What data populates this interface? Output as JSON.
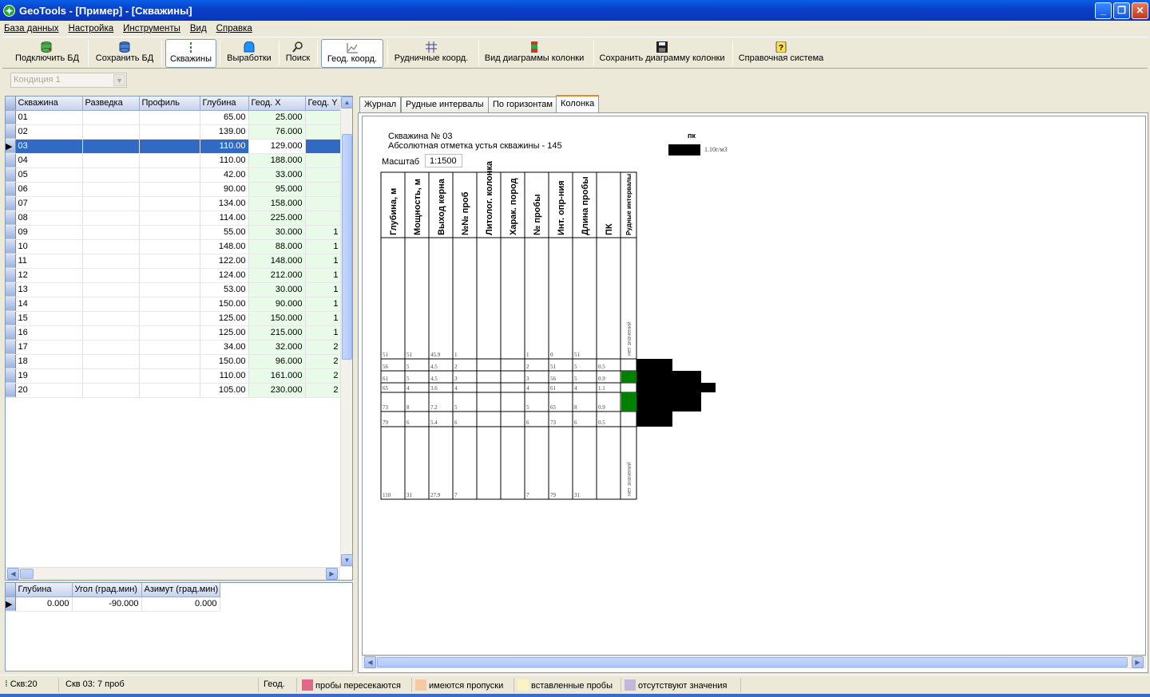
{
  "window": {
    "title": "GeoTools - [Пример] - [Скважины]",
    "min": "_",
    "max": "❐",
    "close": "✕"
  },
  "menu": [
    "База данных",
    "Настройка",
    "Инструменты",
    "Вид",
    "Справка"
  ],
  "toolbar": [
    {
      "label": "Подключить БД",
      "icon": "db-connect-icon"
    },
    {
      "label": "Сохранить БД",
      "icon": "db-save-icon"
    },
    {
      "label": "Скважины",
      "icon": "wells-icon",
      "active": true
    },
    {
      "label": "Выработки",
      "icon": "workings-icon"
    },
    {
      "label": "Поиск",
      "icon": "search-icon"
    },
    {
      "label": "Геод. коорд.",
      "icon": "geod-coords-icon",
      "active": true
    },
    {
      "label": "Рудничные коорд.",
      "icon": "mine-coords-icon"
    },
    {
      "label": "Вид диаграммы колонки",
      "icon": "column-diagram-icon"
    },
    {
      "label": "Сохранить диаграмму колонки",
      "icon": "save-diagram-icon"
    },
    {
      "label": "Справочная система",
      "icon": "help-icon"
    }
  ],
  "condition": {
    "value": "Кондиция 1"
  },
  "wells": {
    "columns": [
      "Скважина",
      "Разведка",
      "Профиль",
      "Глубина",
      "Геод. X",
      "Геод. Y"
    ],
    "selected_row": 2,
    "rows": [
      [
        "01",
        "",
        "",
        "65.00",
        "25.000",
        ""
      ],
      [
        "02",
        "",
        "",
        "139.00",
        "76.000",
        ""
      ],
      [
        "03",
        "",
        "",
        "110.00",
        "129.000",
        ""
      ],
      [
        "04",
        "",
        "",
        "110.00",
        "188.000",
        ""
      ],
      [
        "05",
        "",
        "",
        "42.00",
        "33.000",
        ""
      ],
      [
        "06",
        "",
        "",
        "90.00",
        "95.000",
        ""
      ],
      [
        "07",
        "",
        "",
        "134.00",
        "158.000",
        ""
      ],
      [
        "08",
        "",
        "",
        "114.00",
        "225.000",
        ""
      ],
      [
        "09",
        "",
        "",
        "55.00",
        "30.000",
        "1"
      ],
      [
        "10",
        "",
        "",
        "148.00",
        "88.000",
        "1"
      ],
      [
        "11",
        "",
        "",
        "122.00",
        "148.000",
        "1"
      ],
      [
        "12",
        "",
        "",
        "124.00",
        "212.000",
        "1"
      ],
      [
        "13",
        "",
        "",
        "53.00",
        "30.000",
        "1"
      ],
      [
        "14",
        "",
        "",
        "150.00",
        "90.000",
        "1"
      ],
      [
        "15",
        "",
        "",
        "125.00",
        "150.000",
        "1"
      ],
      [
        "16",
        "",
        "",
        "125.00",
        "215.000",
        "1"
      ],
      [
        "17",
        "",
        "",
        "34.00",
        "32.000",
        "2"
      ],
      [
        "18",
        "",
        "",
        "150.00",
        "96.000",
        "2"
      ],
      [
        "19",
        "",
        "",
        "110.00",
        "161.000",
        "2"
      ],
      [
        "20",
        "",
        "",
        "105.00",
        "230.000",
        "2"
      ]
    ]
  },
  "inclinometry": {
    "columns": [
      "Глубина",
      "Угол (град.мин)",
      "Азимут (град.мин)"
    ],
    "rows": [
      [
        "0.000",
        "-90.000",
        "0.000"
      ]
    ]
  },
  "tabs": [
    "Журнал",
    "Рудные интервалы",
    "По горизонтам",
    "Колонка"
  ],
  "active_tab": 3,
  "column": {
    "well_title": "Скважина № 03",
    "elevation": "Абсолютная отметка устья скважины - 145",
    "scale_label": "Масштаб",
    "scale_value": "1:1500",
    "pk_title": "пк",
    "pk_unit": "1.10г/м3",
    "headers": [
      "Глубина, м",
      "Мощность, м",
      "Выход керна",
      "№№ проб",
      "Литолог. колонка",
      "Харак. пород",
      "№ пробы",
      "Инт. опр-ния",
      "Длина пробы",
      "ПК",
      "Рудные интервалы"
    ],
    "no_values": "нет значений",
    "rows": [
      {
        "v": [
          "51",
          "51",
          "45.9",
          "1",
          "",
          "",
          "1",
          "0",
          "51",
          ""
        ]
      },
      {
        "v": [
          "56",
          "5",
          "4.5",
          "2",
          "",
          "",
          "2",
          "51",
          "5",
          "0.5"
        ]
      },
      {
        "v": [
          "61",
          "5",
          "4.5",
          "3",
          "",
          "",
          "3",
          "56",
          "5",
          "0.9"
        ]
      },
      {
        "v": [
          "65",
          "4",
          "3.6",
          "4",
          "",
          "",
          "4",
          "61",
          "4",
          "1.1"
        ]
      },
      {
        "v": [
          "73",
          "8",
          "7.2",
          "5",
          "",
          "",
          "5",
          "65",
          "8",
          "0.9"
        ]
      },
      {
        "v": [
          "79",
          "6",
          "5.4",
          "6",
          "",
          "",
          "6",
          "73",
          "6",
          "0.5"
        ]
      },
      {
        "v": [
          "110",
          "31",
          "27.9",
          "7",
          "",
          "",
          "7",
          "79",
          "31",
          ""
        ]
      }
    ],
    "ore_color": "#008000",
    "pk_bar_color": "#000000",
    "pk_values": [
      0.5,
      0.9,
      1.1,
      0.9,
      0.5
    ]
  },
  "status": {
    "wells_count": "Скв:20",
    "well_info": "Скв 03: 7 проб",
    "coord_mode": "Геод.",
    "legend": [
      {
        "label": "пробы пересекаются",
        "color": "#e0698a"
      },
      {
        "label": "имеются пропуски",
        "color": "#f7c9a2"
      },
      {
        "label": "вставленные пробы",
        "color": "#fbf3c2"
      },
      {
        "label": "отсутствуют значения",
        "color": "#c3b8dc"
      }
    ]
  }
}
